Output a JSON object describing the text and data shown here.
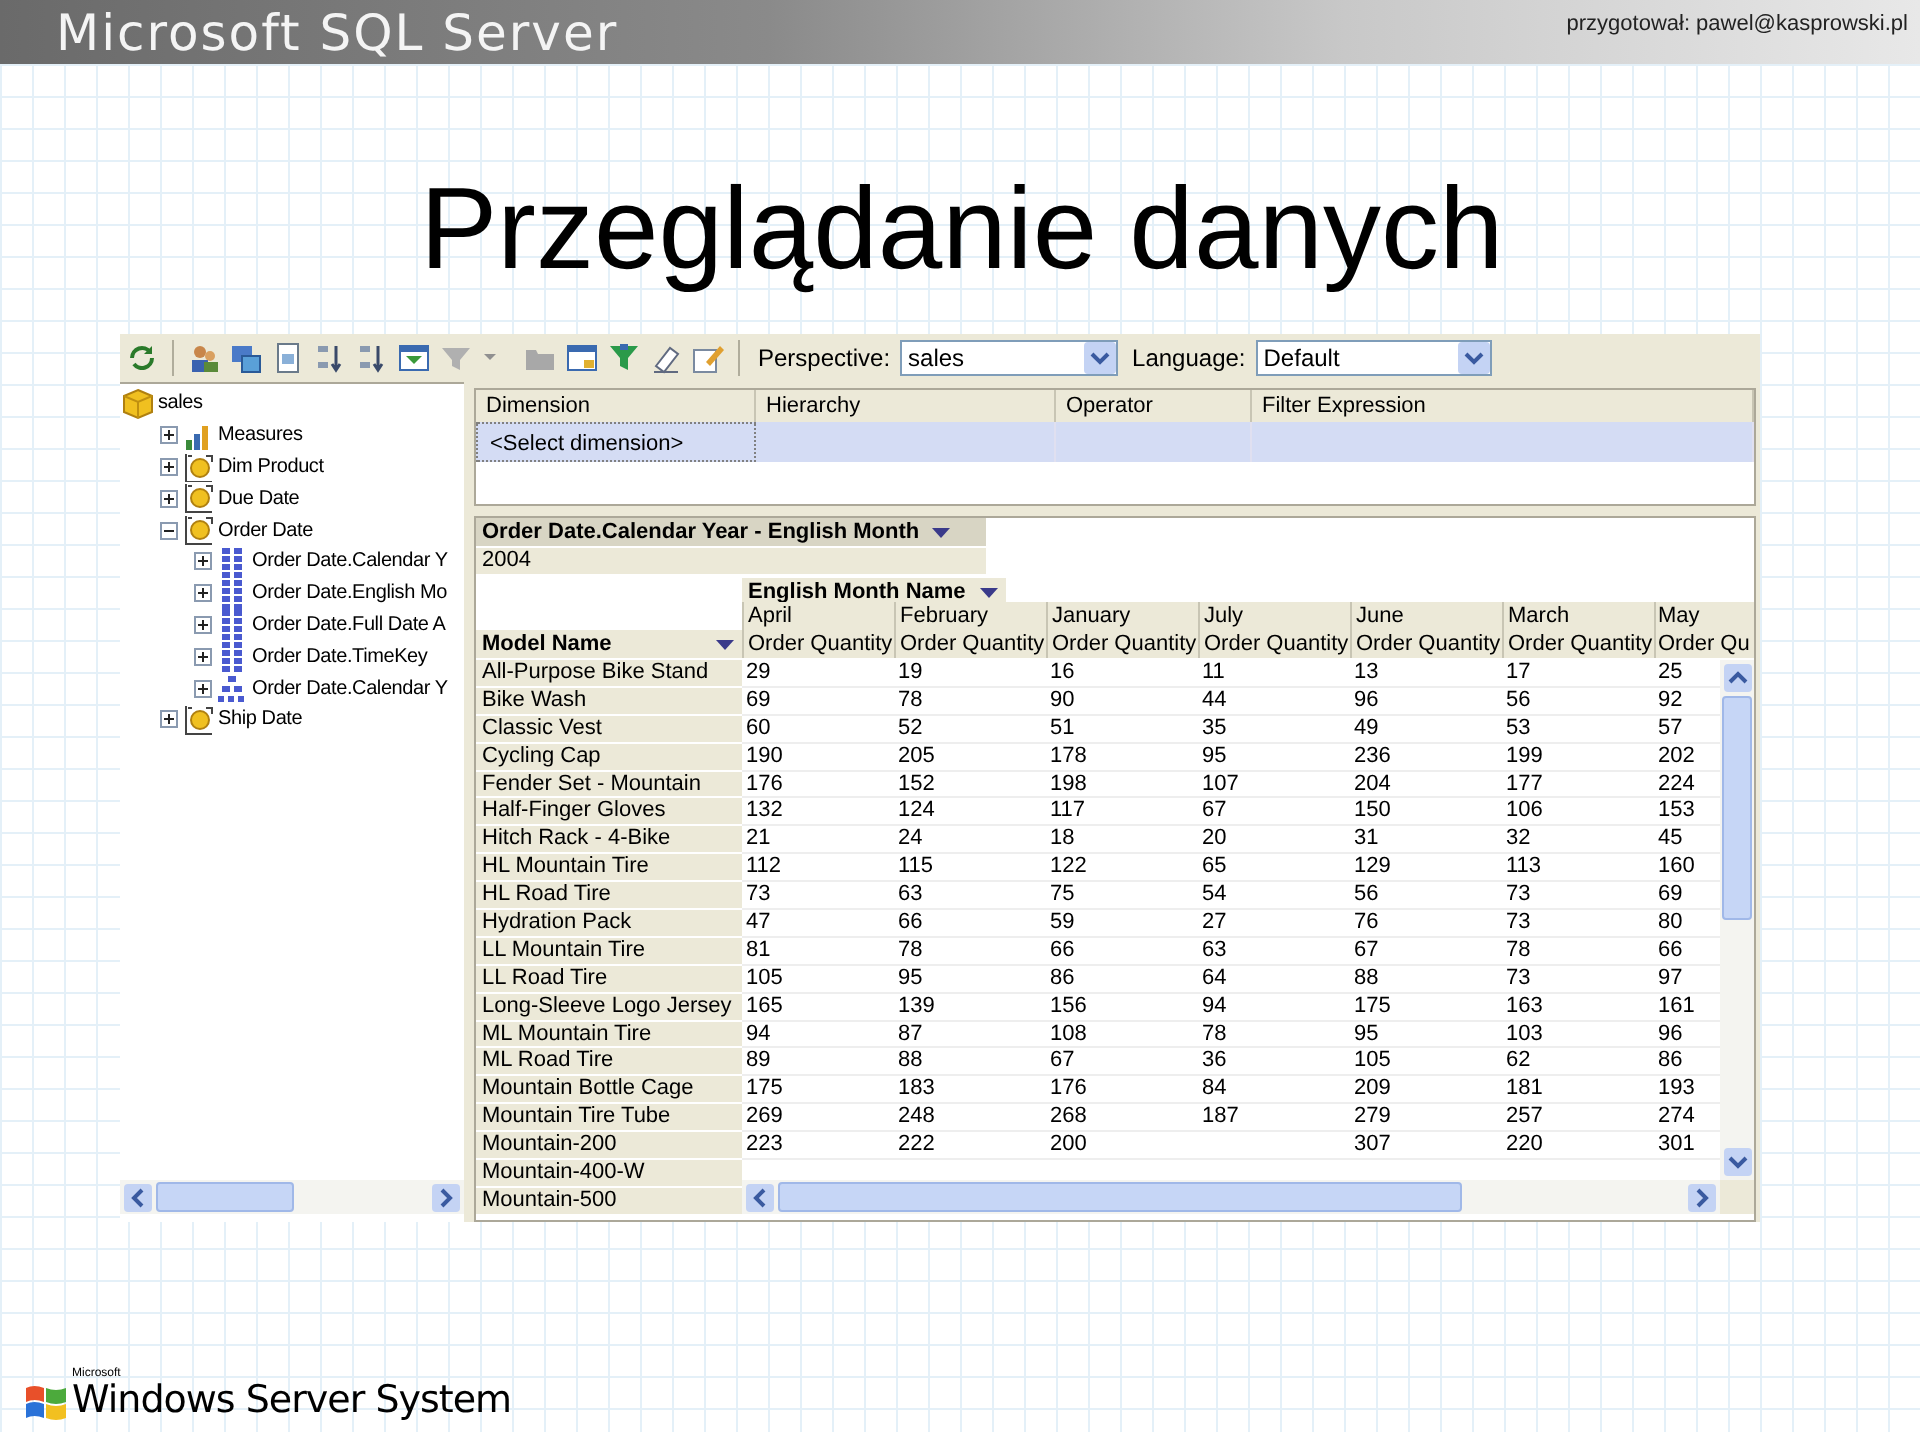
{
  "slide": {
    "banner": {
      "product": "Microsoft SQL Server",
      "author": "przygotował: pawel@kasprowski.pl"
    },
    "title": "Przeglądanie danych",
    "footer": {
      "maker": "Microsoft",
      "brand": "Windows Server System"
    }
  },
  "toolbar": {
    "perspective": {
      "label": "Perspective:",
      "value": "sales"
    },
    "language": {
      "label": "Language:",
      "value": "Default"
    }
  },
  "tree": {
    "label": "sales",
    "kind": "cube",
    "children": [
      {
        "label": "Measures",
        "kind": "measures",
        "expanded": false
      },
      {
        "label": "Dim Product",
        "kind": "dimension",
        "expanded": false
      },
      {
        "label": "Due Date",
        "kind": "dimension",
        "expanded": false
      },
      {
        "label": "Order Date",
        "kind": "dimension",
        "expanded": true,
        "children": [
          {
            "label": "Order Date.Calendar Y",
            "kind": "attribute",
            "expanded": false
          },
          {
            "label": "Order Date.English Mo",
            "kind": "attribute",
            "expanded": false
          },
          {
            "label": "Order Date.Full Date A",
            "kind": "attribute",
            "expanded": false
          },
          {
            "label": "Order Date.TimeKey",
            "kind": "attribute",
            "expanded": false
          },
          {
            "label": "Order Date.Calendar Y",
            "kind": "hierarchy",
            "expanded": false
          }
        ]
      },
      {
        "label": "Ship Date",
        "kind": "dimension",
        "expanded": false
      }
    ]
  },
  "filter_grid": {
    "columns": [
      "Dimension",
      "Hierarchy",
      "Operator",
      "Filter Expression"
    ],
    "rows": [
      {
        "dimension": "<Select dimension>",
        "selected": true
      }
    ]
  },
  "pivot": {
    "filter_field": "Order Date.Calendar Year - English Month",
    "filter_value": "2004",
    "column_field": "English Month Name",
    "row_field": "Model Name",
    "months": [
      "April",
      "February",
      "January",
      "July",
      "June",
      "March",
      "May"
    ],
    "measures": [
      "Order Quantity",
      "Order Quantity",
      "Order Quantity",
      "Order Quantity",
      "Order Quantity",
      "Order Quantity",
      "Order Qu"
    ],
    "rows": [
      {
        "name": "All-Purpose Bike Stand",
        "values": [
          "29",
          "19",
          "16",
          "11",
          "13",
          "17",
          "25"
        ]
      },
      {
        "name": "Bike Wash",
        "values": [
          "69",
          "78",
          "90",
          "44",
          "96",
          "56",
          "92"
        ]
      },
      {
        "name": "Classic Vest",
        "values": [
          "60",
          "52",
          "51",
          "35",
          "49",
          "53",
          "57"
        ]
      },
      {
        "name": "Cycling Cap",
        "values": [
          "190",
          "205",
          "178",
          "95",
          "236",
          "199",
          "202"
        ]
      },
      {
        "name": "Fender Set - Mountain",
        "values": [
          "176",
          "152",
          "198",
          "107",
          "204",
          "177",
          "224"
        ]
      },
      {
        "name": "Half-Finger Gloves",
        "values": [
          "132",
          "124",
          "117",
          "67",
          "150",
          "106",
          "153"
        ]
      },
      {
        "name": "Hitch Rack - 4-Bike",
        "values": [
          "21",
          "24",
          "18",
          "20",
          "31",
          "32",
          "45"
        ]
      },
      {
        "name": "HL Mountain Tire",
        "values": [
          "112",
          "115",
          "122",
          "65",
          "129",
          "113",
          "160"
        ]
      },
      {
        "name": "HL Road Tire",
        "values": [
          "73",
          "63",
          "75",
          "54",
          "56",
          "73",
          "69"
        ]
      },
      {
        "name": "Hydration Pack",
        "values": [
          "47",
          "66",
          "59",
          "27",
          "76",
          "73",
          "80"
        ]
      },
      {
        "name": "LL Mountain Tire",
        "values": [
          "81",
          "78",
          "66",
          "63",
          "67",
          "78",
          "66"
        ]
      },
      {
        "name": "LL Road Tire",
        "values": [
          "105",
          "95",
          "86",
          "64",
          "88",
          "73",
          "97"
        ]
      },
      {
        "name": "Long-Sleeve Logo Jersey",
        "values": [
          "165",
          "139",
          "156",
          "94",
          "175",
          "163",
          "161"
        ]
      },
      {
        "name": "ML Mountain Tire",
        "values": [
          "94",
          "87",
          "108",
          "78",
          "95",
          "103",
          "96"
        ]
      },
      {
        "name": "ML Road Tire",
        "values": [
          "89",
          "88",
          "67",
          "36",
          "105",
          "62",
          "86"
        ]
      },
      {
        "name": "Mountain Bottle Cage",
        "values": [
          "175",
          "183",
          "176",
          "84",
          "209",
          "181",
          "193"
        ]
      },
      {
        "name": "Mountain Tire Tube",
        "values": [
          "269",
          "248",
          "268",
          "187",
          "279",
          "257",
          "274"
        ]
      },
      {
        "name": "Mountain-200",
        "values": [
          "223",
          "222",
          "200",
          {
            "empty": true
          },
          "307",
          "220",
          "301"
        ]
      },
      {
        "name": "Mountain-400-W"
      },
      {
        "name": "Mountain-500"
      }
    ]
  }
}
